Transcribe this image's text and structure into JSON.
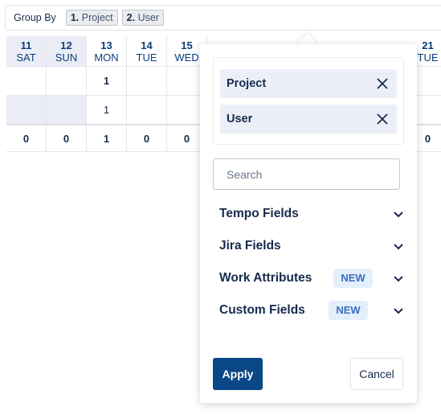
{
  "group_by": {
    "label": "Group By",
    "tags": [
      {
        "num": "1.",
        "name": "Project"
      },
      {
        "num": "2.",
        "name": "User"
      }
    ]
  },
  "days": [
    {
      "d": "11",
      "w": "SAT",
      "weekend": true,
      "r1": "",
      "r2": "",
      "tot": "0"
    },
    {
      "d": "12",
      "w": "SUN",
      "weekend": true,
      "r1": "",
      "r2": "",
      "tot": "0"
    },
    {
      "d": "13",
      "w": "MON",
      "weekend": false,
      "r1": "1",
      "r2": "1",
      "tot": "1"
    },
    {
      "d": "14",
      "w": "TUE",
      "weekend": false,
      "r1": "",
      "r2": "",
      "tot": "0"
    },
    {
      "d": "15",
      "w": "WED",
      "weekend": false,
      "r1": "",
      "r2": "",
      "tot": "0"
    },
    {
      "d": "21",
      "w": "TUE",
      "weekend": false,
      "r1": "",
      "r2": "",
      "tot": "0"
    }
  ],
  "popup": {
    "selected": [
      {
        "label": "Project"
      },
      {
        "label": "User"
      }
    ],
    "search_placeholder": "Search",
    "sections": [
      {
        "label": "Tempo Fields",
        "badge": ""
      },
      {
        "label": "Jira Fields",
        "badge": ""
      },
      {
        "label": "Work Attributes",
        "badge": "NEW"
      },
      {
        "label": "Custom Fields",
        "badge": "NEW"
      }
    ],
    "apply": "Apply",
    "cancel": "Cancel"
  },
  "colors": {
    "accent": "#0a4787",
    "weekend": "#eaedf6",
    "badge": "#e3effd"
  }
}
